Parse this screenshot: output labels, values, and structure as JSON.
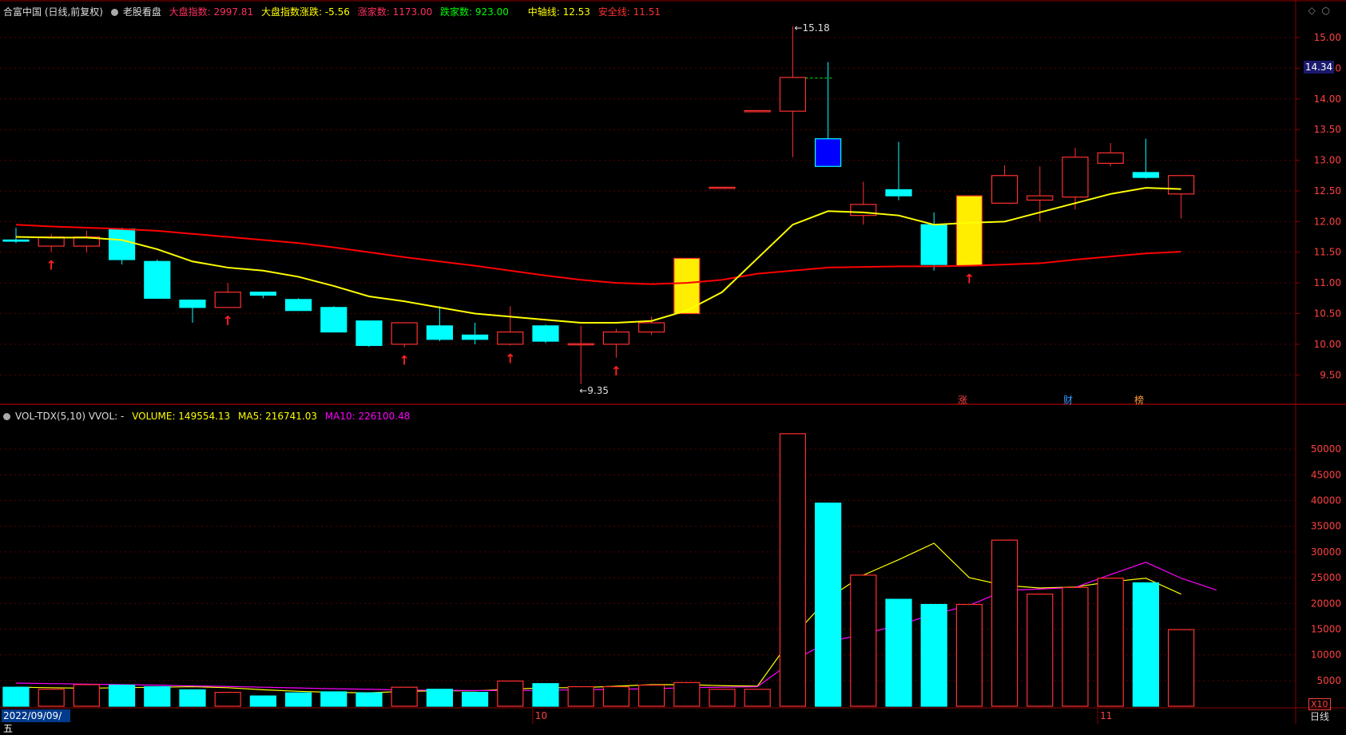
{
  "header": {
    "stock": "合富中国 (日线,前复权)",
    "template": "老股看盘",
    "index_label": "大盘指数: 2997.81",
    "index_change": "大盘指数涨跌: -5.56",
    "up_count": "涨家数: 1173.00",
    "down_count": "跌家数: 923.00",
    "mid_line": "中轴线: 12.53",
    "safe_line": "安全线: 11.51"
  },
  "volume_header": {
    "name": "VOL-TDX(5,10) VVOL: -",
    "volume": "VOLUME: 149554.13",
    "ma5": "MA5: 216741.03",
    "ma10": "MA10: 226100.48"
  },
  "current_price": "14.34",
  "date_label": "2022/09/09/五",
  "frequency": "日线",
  "x10_label": "X10",
  "markers": {
    "zhang": "涨",
    "cai": "财",
    "bang": "榜"
  },
  "annotations": {
    "high": "15.18",
    "low": "9.35"
  },
  "colors": {
    "up": "#ff3030",
    "down": "#00ffff",
    "ma_short": "#ffff00",
    "ma_long": "#ff0000",
    "vol_ma5": "#ffff00",
    "vol_ma10": "#ff00ff",
    "highlight": "#ffee00",
    "blue": "#0000ff"
  },
  "chart_data": {
    "type": "candlestick",
    "ylim": [
      9.1,
      15.3
    ],
    "y_ticks": [
      9.5,
      10.0,
      10.5,
      11.0,
      11.5,
      12.0,
      12.5,
      13.0,
      13.5,
      14.0,
      14.5,
      15.0
    ],
    "vol_ylim": [
      0,
      55000
    ],
    "vol_ticks": [
      5000,
      10000,
      15000,
      20000,
      25000,
      30000,
      35000,
      40000,
      45000,
      50000
    ],
    "x_labels": [
      {
        "index": 15,
        "text": "10"
      },
      {
        "index": 31,
        "text": "11"
      }
    ],
    "candles": [
      {
        "o": 11.7,
        "h": 11.9,
        "l": 11.65,
        "c": 11.68,
        "v": 3700
      },
      {
        "o": 11.6,
        "h": 11.8,
        "l": 11.5,
        "c": 11.75,
        "v": 3300
      },
      {
        "o": 11.6,
        "h": 11.85,
        "l": 11.5,
        "c": 11.75,
        "v": 4200
      },
      {
        "o": 11.88,
        "h": 11.9,
        "l": 11.3,
        "c": 11.38,
        "v": 4100
      },
      {
        "o": 11.35,
        "h": 11.38,
        "l": 10.75,
        "c": 10.75,
        "v": 3800
      },
      {
        "o": 10.72,
        "h": 10.72,
        "l": 10.35,
        "c": 10.6,
        "v": 3200
      },
      {
        "o": 10.6,
        "h": 11.0,
        "l": 10.6,
        "c": 10.85,
        "v": 2700
      },
      {
        "o": 10.85,
        "h": 10.85,
        "l": 10.75,
        "c": 10.8,
        "v": 2000
      },
      {
        "o": 10.73,
        "h": 10.75,
        "l": 10.55,
        "c": 10.55,
        "v": 2600
      },
      {
        "o": 10.6,
        "h": 10.62,
        "l": 10.2,
        "c": 10.2,
        "v": 2800
      },
      {
        "o": 10.38,
        "h": 10.38,
        "l": 9.96,
        "c": 9.98,
        "v": 2600
      },
      {
        "o": 10.0,
        "h": 10.35,
        "l": 9.95,
        "c": 10.35,
        "v": 3700
      },
      {
        "o": 10.3,
        "h": 10.62,
        "l": 10.05,
        "c": 10.08,
        "v": 3300
      },
      {
        "o": 10.15,
        "h": 10.35,
        "l": 10.0,
        "c": 10.08,
        "v": 2700
      },
      {
        "o": 10.0,
        "h": 10.62,
        "l": 9.98,
        "c": 10.2,
        "v": 4900
      },
      {
        "o": 10.3,
        "h": 10.32,
        "l": 10.02,
        "c": 10.05,
        "v": 4400
      },
      {
        "o": 10.0,
        "h": 10.3,
        "l": 9.35,
        "c": 10.0,
        "v": 3800
      },
      {
        "o": 10.0,
        "h": 10.25,
        "l": 9.78,
        "c": 10.2,
        "v": 3800
      },
      {
        "o": 10.2,
        "h": 10.45,
        "l": 10.15,
        "c": 10.35,
        "v": 4100
      },
      {
        "o": 10.5,
        "h": 11.4,
        "l": 10.5,
        "c": 11.4,
        "v": 4600
      },
      {
        "o": 12.55,
        "h": 12.55,
        "l": 12.55,
        "c": 12.55,
        "v": 3300
      },
      {
        "o": 13.8,
        "h": 13.8,
        "l": 13.8,
        "c": 13.8,
        "v": 3300
      },
      {
        "o": 13.8,
        "h": 15.18,
        "l": 13.05,
        "c": 14.35,
        "v": 53000
      },
      {
        "o": 13.35,
        "h": 14.6,
        "l": 12.9,
        "c": 12.9,
        "v": 39500
      },
      {
        "o": 12.1,
        "h": 12.65,
        "l": 11.95,
        "c": 12.28,
        "v": 25500
      },
      {
        "o": 12.52,
        "h": 13.3,
        "l": 12.35,
        "c": 12.42,
        "v": 20800
      },
      {
        "o": 11.95,
        "h": 12.15,
        "l": 11.2,
        "c": 11.3,
        "v": 19800
      },
      {
        "o": 11.28,
        "h": 12.42,
        "l": 11.28,
        "c": 12.42,
        "v": 19800
      },
      {
        "o": 12.3,
        "h": 12.92,
        "l": 12.3,
        "c": 12.75,
        "v": 32300
      },
      {
        "o": 12.35,
        "h": 12.9,
        "l": 12.0,
        "c": 12.42,
        "v": 21800
      },
      {
        "o": 12.4,
        "h": 13.2,
        "l": 12.2,
        "c": 13.05,
        "v": 23100
      },
      {
        "o": 12.95,
        "h": 13.28,
        "l": 12.9,
        "c": 13.12,
        "v": 24900
      },
      {
        "o": 12.8,
        "h": 13.35,
        "l": 12.7,
        "c": 12.72,
        "v": 24000
      },
      {
        "o": 12.45,
        "h": 12.75,
        "l": 12.05,
        "c": 12.75,
        "v": 14900
      }
    ],
    "ma_short": [
      11.75,
      11.74,
      11.74,
      11.7,
      11.55,
      11.35,
      11.25,
      11.2,
      11.1,
      10.95,
      10.78,
      10.7,
      10.6,
      10.5,
      10.45,
      10.4,
      10.35,
      10.35,
      10.38,
      10.55,
      10.85,
      11.4,
      11.95,
      12.17,
      12.15,
      12.1,
      11.95,
      11.98,
      12.0,
      12.15,
      12.3,
      12.45,
      12.55,
      12.53
    ],
    "ma_long": [
      11.95,
      11.92,
      11.9,
      11.88,
      11.85,
      11.8,
      11.75,
      11.7,
      11.65,
      11.58,
      11.5,
      11.42,
      11.35,
      11.28,
      11.2,
      11.12,
      11.05,
      11.0,
      10.98,
      11.0,
      11.05,
      11.15,
      11.2,
      11.25,
      11.26,
      11.27,
      11.27,
      11.28,
      11.3,
      11.32,
      11.38,
      11.43,
      11.48,
      11.51
    ],
    "vol_ma5": [
      3700,
      3600,
      3500,
      3600,
      3700,
      3800,
      3600,
      3200,
      2900,
      2700,
      2600,
      2900,
      3000,
      3000,
      3300,
      3600,
      3600,
      3900,
      4200,
      4200,
      4000,
      3900,
      13500,
      21000,
      25500,
      28500,
      31700,
      25000,
      23500,
      23000,
      23200,
      24200,
      24900,
      21800
    ],
    "vol_ma10": [
      4500,
      4400,
      4300,
      4200,
      4100,
      3950,
      3850,
      3700,
      3550,
      3400,
      3300,
      3150,
      3100,
      3050,
      3050,
      3100,
      3200,
      3300,
      3400,
      3600,
      3700,
      3800,
      8800,
      12500,
      14000,
      15800,
      17900,
      19600,
      22500,
      22800,
      23100,
      25600,
      28000,
      24900,
      22600
    ],
    "up_arrows": [
      1,
      6,
      11,
      14,
      17,
      27
    ],
    "highlight_yellow": [
      19,
      27
    ],
    "highlight_blue": [
      23
    ]
  }
}
